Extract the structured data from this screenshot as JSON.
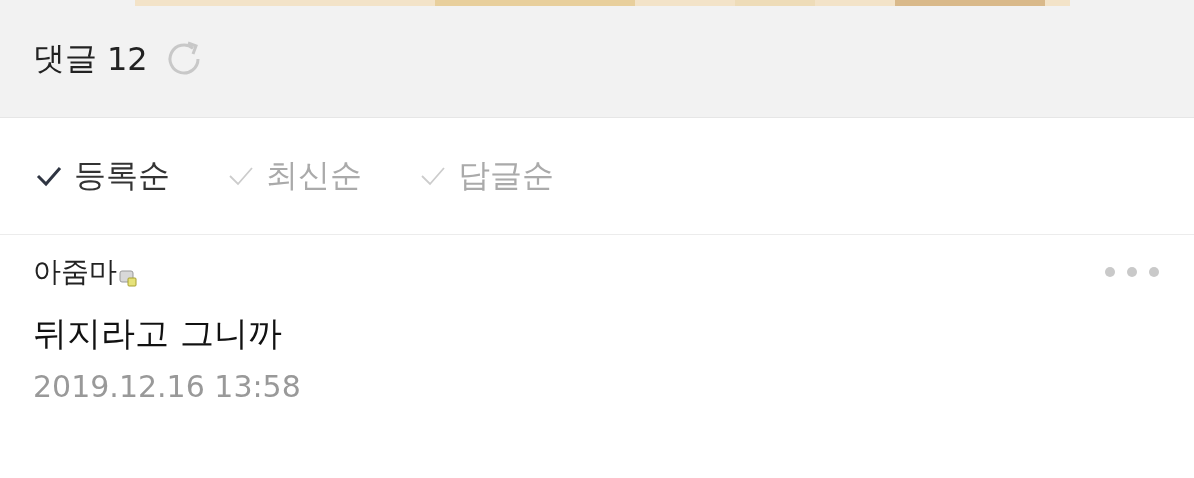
{
  "header": {
    "title": "댓글",
    "count": "12"
  },
  "sort_options": [
    {
      "label": "등록순",
      "selected": true
    },
    {
      "label": "최신순",
      "selected": false
    },
    {
      "label": "답글순",
      "selected": false
    }
  ],
  "comments": [
    {
      "author": "아줌마",
      "text": "뒤지라고 그니까",
      "date": "2019.12.16 13:58"
    }
  ]
}
